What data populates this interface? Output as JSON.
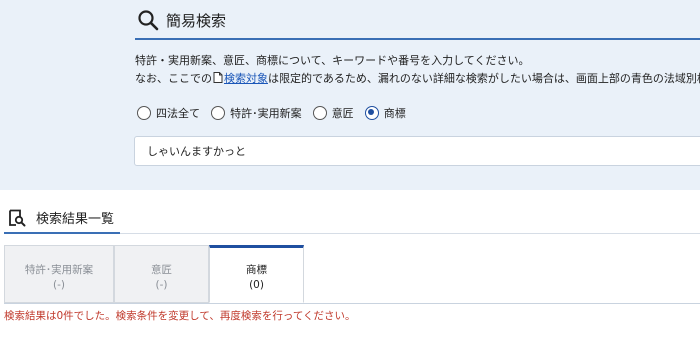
{
  "simple_search": {
    "title": "簡易検索",
    "description_line1": "特許・実用新案、意匠、商標について、キーワードや番号を入力してください。",
    "description_line2_prefix": "なお、ここでの",
    "description_line2_link": "検索対象",
    "description_line2_suffix": "は限定的であるため、漏れのない詳細な検索がしたい場合は、画面上部の青色の法域別検",
    "radio_options": [
      {
        "label": "四法全て",
        "checked": false
      },
      {
        "label": "特許･実用新案",
        "checked": false
      },
      {
        "label": "意匠",
        "checked": false
      },
      {
        "label": "商標",
        "checked": true
      }
    ],
    "search_value": "しゃいんますかっと"
  },
  "results": {
    "title": "検索結果一覧",
    "tabs": [
      {
        "label": "特許･実用新案",
        "count": "(-)",
        "active": false
      },
      {
        "label": "意匠",
        "count": "(-)",
        "active": false
      },
      {
        "label": "商標",
        "count": "(0)",
        "active": true
      }
    ],
    "no_result_message": "検索結果は0件でした。検索条件を変更して、再度検索を行ってください。"
  },
  "colors": {
    "panel_bg": "#eaf1f9",
    "accent": "#1f4fa0",
    "error_text": "#c0392b"
  }
}
